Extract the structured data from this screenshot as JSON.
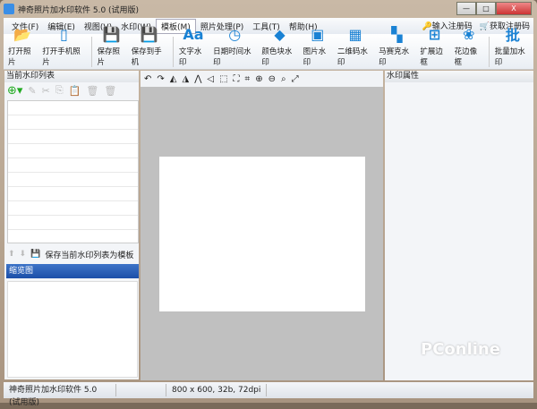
{
  "window": {
    "title": "神奇照片加水印软件 5.0 (试用版)",
    "minimize": "—",
    "maximize": "□",
    "close": "X"
  },
  "menu": [
    "文件(F)",
    "编辑(E)",
    "视图(V)",
    "水印(W)",
    "模板(M)",
    "照片处理(P)",
    "工具(T)",
    "帮助(H)"
  ],
  "menu_active": 4,
  "register": {
    "enter": "输入注册码",
    "buy": "获取注册码"
  },
  "toolbar": [
    {
      "label": "打开照片",
      "icon": "📂"
    },
    {
      "label": "打开手机照片",
      "icon": "▯"
    },
    null,
    {
      "label": "保存照片",
      "icon": "💾"
    },
    {
      "label": "保存到手机",
      "icon": "💾"
    },
    null,
    {
      "label": "文字水印",
      "icon": "Aa"
    },
    {
      "label": "日期时间水印",
      "icon": "◷"
    },
    {
      "label": "颜色块水印",
      "icon": "◆"
    },
    {
      "label": "图片水印",
      "icon": "▣"
    },
    {
      "label": "二维码水印",
      "icon": "▦"
    },
    {
      "label": "马赛克水印",
      "icon": "▚"
    },
    {
      "label": "扩展边框",
      "icon": "⊞"
    },
    {
      "label": "花边像框",
      "icon": "❀"
    },
    null,
    {
      "label": "批量加水印",
      "icon": "批"
    }
  ],
  "left": {
    "title": "当前水印列表",
    "save_template": "保存当前水印列表为模板",
    "thumb_title": "缩览图"
  },
  "canvas_tools": [
    "↶",
    "↷",
    "◭",
    "◮",
    "⋀",
    "◁",
    "⬚",
    "⛶",
    "⌗",
    "⊕",
    "⊖",
    "⌕",
    "⤢"
  ],
  "right": {
    "title": "水印属性"
  },
  "status": {
    "app": "神奇照片加水印软件 5.0 (试用版)",
    "info": "800 x 600, 32b, 72dpi"
  },
  "watermark": "PConline"
}
